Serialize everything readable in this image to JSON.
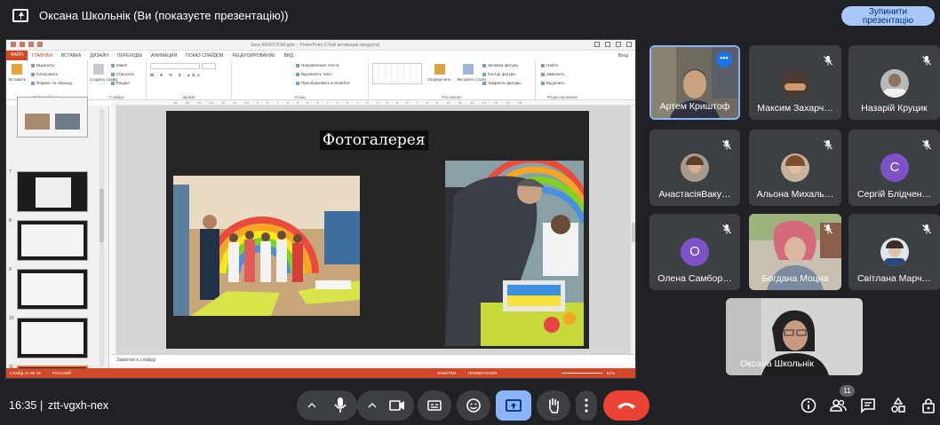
{
  "top": {
    "title": "Оксана Школьнік (Ви (показуєте презентацію))",
    "stop_label_1": "Зупинити",
    "stop_label_2": "презентацію"
  },
  "powerpoint": {
    "titlebar": "Sess KRISTOOM.pptx – PowerPoint (Сбой активации продукта)",
    "tabs": [
      "ФАЙЛ",
      "ГЛАВНАЯ",
      "ВСТАВКА",
      "ДИЗАЙН",
      "ПЕРЕХОДЫ",
      "АНИМАЦИЯ",
      "ПОКАЗ СЛАЙДОВ",
      "РЕЦЕНЗИРОВАНИЕ",
      "ВИД"
    ],
    "login": "Вход",
    "ribbon": {
      "paste": "Вставить",
      "cut": "Вырезать",
      "copy": "Копировать",
      "format_painter": "Формат по образцу",
      "clipboard": "Буфер обмена",
      "create_slide": "Создать слайд",
      "layout": "Макет",
      "reset": "Сбросить",
      "section": "Раздел",
      "slides": "Слайды",
      "font": "Шрифт",
      "text_direction": "Направление текста",
      "align_text": "Выровнять текст",
      "smartart": "Преобразовать в SmartArt",
      "paragraph": "Абзац",
      "arrange": "Упорядочить",
      "quick_styles": "Экспресс-стили",
      "fill": "Заливка фигуры",
      "outline": "Контур фигуры",
      "effects": "Эффекты фигуры",
      "drawing": "Рисование",
      "find": "Найти",
      "replace": "Заменить",
      "select": "Выделить",
      "editing": "Редактирование"
    },
    "ruler_ticks": [
      "16",
      "15",
      "14",
      "13",
      "12",
      "11",
      "10",
      "9",
      "8",
      "7",
      "6",
      "5",
      "4",
      "3",
      "2",
      "1",
      "0",
      "1",
      "2",
      "3",
      "4",
      "5",
      "6",
      "7",
      "8",
      "9",
      "10",
      "11",
      "12",
      "13",
      "14",
      "15",
      "16"
    ],
    "slide_numbers": [
      "7",
      "8",
      "9",
      "10",
      "11"
    ],
    "slide_title": "Фотогалерея",
    "notes": "Заметки к слайду",
    "status_slide": "СЛАЙД 11 ИЗ 18",
    "status_lang": "РУССКИЙ",
    "status_notes": "ЗАМЕТКИ",
    "status_comments": "ПРИМЕЧАНИЯ",
    "zoom": "61%"
  },
  "participants": [
    {
      "name": "Артем Криштоф",
      "type": "video",
      "active": true
    },
    {
      "name": "Максим Захарч…",
      "type": "avatar",
      "muted": true
    },
    {
      "name": "Назарій Круцик",
      "type": "avatar",
      "muted": true
    },
    {
      "name": "АнастасіяВаку…",
      "type": "avatar",
      "muted": true
    },
    {
      "name": "Альона Михаль…",
      "type": "avatar",
      "muted": true
    },
    {
      "name": "Сергій Блідчен…",
      "type": "letter",
      "letter": "С",
      "muted": true
    },
    {
      "name": "Олена Самбор…",
      "type": "letter",
      "letter": "О",
      "muted": true
    },
    {
      "name": "Богдана Моцна",
      "type": "video",
      "muted": true
    },
    {
      "name": "Світлана Марч…",
      "type": "avatar",
      "muted": true
    },
    {
      "name": "Оксана Школьнік",
      "type": "video"
    }
  ],
  "bottom": {
    "time": "16:35",
    "separator": "|",
    "meeting_code": "ztt-vgxh-nex",
    "people_count": "11"
  },
  "colors": {
    "accent": "#8ab4f8",
    "end_call": "#ea4335",
    "ppt_orange": "#d24726"
  }
}
